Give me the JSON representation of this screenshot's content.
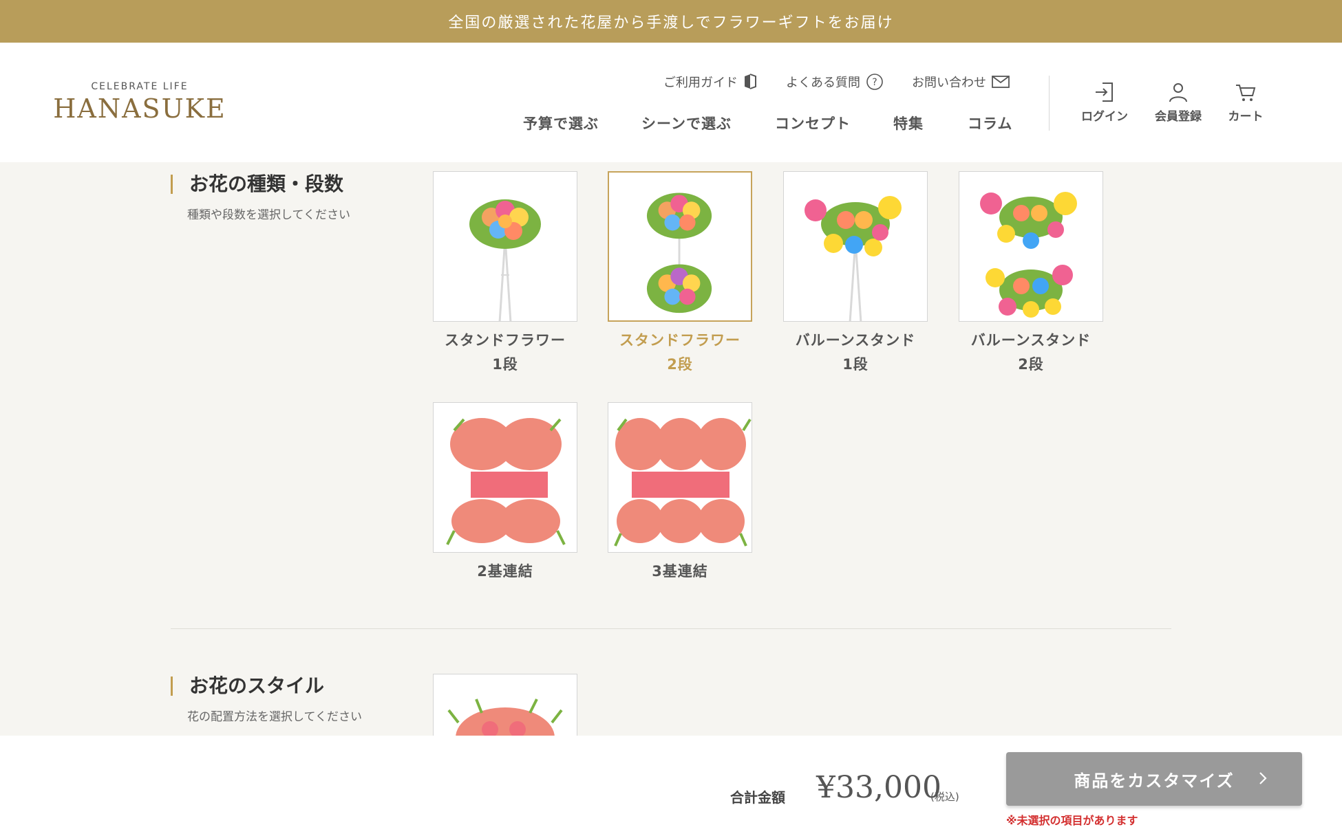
{
  "topbar": {
    "text": "全国の厳選された花屋から手渡しでフラワーギフトをお届け"
  },
  "logo": {
    "tagline": "CELEBRATE LIFE",
    "wordmark": "HANASUKE"
  },
  "header": {
    "utility_links": [
      {
        "label": "ご利用ガイド",
        "icon": "guide-icon"
      },
      {
        "label": "よくある質問",
        "icon": "question-icon"
      },
      {
        "label": "お問い合わせ",
        "icon": "mail-icon"
      }
    ],
    "nav": [
      "予算で選ぶ",
      "シーンで選ぶ",
      "コンセプト",
      "特集",
      "コラム"
    ],
    "account": [
      {
        "label": "ログイン",
        "icon": "login-icon"
      },
      {
        "label": "会員登録",
        "icon": "user-icon"
      },
      {
        "label": "カート",
        "icon": "cart-icon"
      }
    ]
  },
  "section_type": {
    "title": "お花の種類・段数",
    "subtitle": "種類や段数を選択してください",
    "options": [
      {
        "label": "スタンドフラワー\n1段",
        "selected": false
      },
      {
        "label": "スタンドフラワー\n2段",
        "selected": true
      },
      {
        "label": "バルーンスタンド\n1段",
        "selected": false
      },
      {
        "label": "バルーンスタンド\n2段",
        "selected": false
      },
      {
        "label": "2基連結",
        "selected": false
      },
      {
        "label": "3基連結",
        "selected": false
      }
    ]
  },
  "section_style": {
    "title": "お花のスタイル",
    "subtitle": "花の配置方法を選択してください"
  },
  "footer": {
    "total_label": "合計金額",
    "price": "¥33,000",
    "tax_note": "(税込)",
    "cta_label": "商品をカスタマイズ",
    "warning": "※未選択の項目があります"
  },
  "colors": {
    "brand_gold": "#b89d5a",
    "selected_gold": "#c29d4f",
    "warning_red": "#d32f2f",
    "cta_gray": "#9a9a9a"
  }
}
